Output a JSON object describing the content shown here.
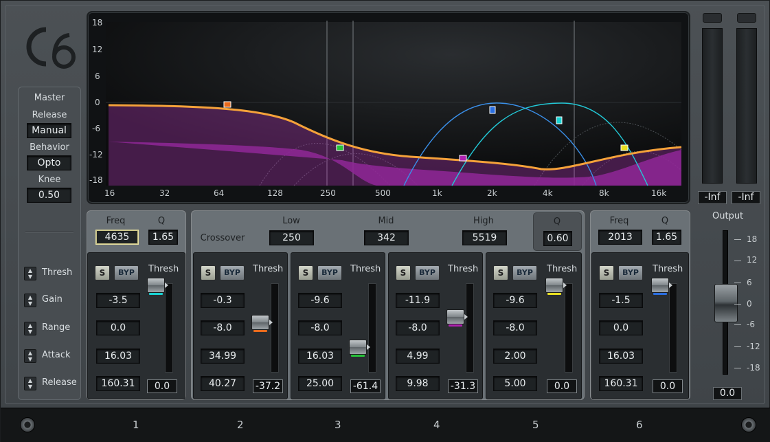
{
  "logo": "C6",
  "master": {
    "title": "Master",
    "release_label": "Release",
    "release_value": "Manual",
    "behavior_label": "Behavior",
    "behavior_value": "Opto",
    "knee_label": "Knee",
    "knee_value": "0.50",
    "rows": [
      "Thresh",
      "Gain",
      "Range",
      "Attack",
      "Release"
    ]
  },
  "graph": {
    "y_ticks": [
      "18",
      "12",
      "6",
      "0",
      "-6",
      "-12",
      "-18"
    ],
    "x_ticks": [
      "16",
      "32",
      "64",
      "128",
      "250",
      "500",
      "1k",
      "2k",
      "4k",
      "8k",
      "16k"
    ]
  },
  "meters": {
    "left": "-Inf",
    "right": "-Inf"
  },
  "output": {
    "label": "Output",
    "ticks": [
      "18",
      "12",
      "6",
      "0",
      "-6",
      "-12",
      "-18"
    ],
    "value": "0.0"
  },
  "crossover": {
    "label": "Crossover",
    "low_label": "Low",
    "low": "250",
    "mid_label": "Mid",
    "mid": "342",
    "high_label": "High",
    "high": "5519",
    "q_label": "Q",
    "q": "0.60"
  },
  "buttons": {
    "solo": "S",
    "bypass": "BYP",
    "thresh": "Thresh"
  },
  "band1": {
    "freq_label": "Freq",
    "freq": "4635",
    "q_label": "Q",
    "q": "1.65",
    "values": [
      "-3.5",
      "0.0",
      "16.03",
      "160.31"
    ],
    "thresh": "0.0"
  },
  "band2": {
    "values": [
      "-0.3",
      "-8.0",
      "34.99",
      "40.27"
    ],
    "thresh": "-37.2"
  },
  "band3": {
    "values": [
      "-9.6",
      "-8.0",
      "16.03",
      "25.00"
    ],
    "thresh": "-61.4"
  },
  "band4": {
    "values": [
      "-11.9",
      "-8.0",
      "4.99",
      "9.98"
    ],
    "thresh": "-31.3"
  },
  "band5": {
    "values": [
      "-9.6",
      "-8.0",
      "2.00",
      "5.00"
    ],
    "thresh": "0.0"
  },
  "band6": {
    "freq_label": "Freq",
    "freq": "2013",
    "q_label": "Q",
    "q": "1.65",
    "values": [
      "-1.5",
      "0.0",
      "16.03",
      "160.31"
    ],
    "thresh": "0.0"
  },
  "band_numbers": [
    "1",
    "2",
    "3",
    "4",
    "5",
    "6"
  ],
  "colors": {
    "curve": "#f5a23a",
    "fill": "#7e1f86",
    "band1": "#19d4d4",
    "band2": "#e86a1c",
    "band3": "#27c23a",
    "band4": "#b022b0",
    "band5": "#e8e021",
    "band6": "#2a6ee0"
  }
}
